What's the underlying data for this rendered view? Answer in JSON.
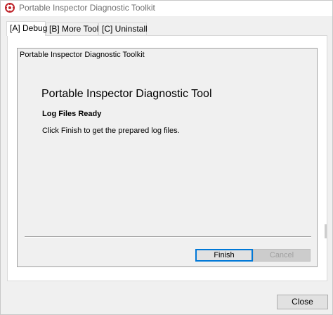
{
  "window": {
    "title": "Portable Inspector Diagnostic Toolkit"
  },
  "tabs": [
    {
      "label": "[A] Debug",
      "active": true
    },
    {
      "label": "[B] More Tools",
      "active": false
    },
    {
      "label": "[C] Uninstall",
      "active": false
    }
  ],
  "wizard": {
    "header": "Portable Inspector Diagnostic Toolkit",
    "title": "Portable Inspector Diagnostic Tool",
    "subtitle": "Log Files Ready",
    "body": "Click Finish to get the prepared log files.",
    "finish_label": "Finish",
    "cancel_label": "Cancel",
    "cancel_disabled": true
  },
  "footer": {
    "close_label": "Close"
  },
  "colors": {
    "accent": "#0078d7",
    "app_icon": "#c0272d"
  },
  "icons": {
    "app": "trend-micro-logo-icon"
  }
}
